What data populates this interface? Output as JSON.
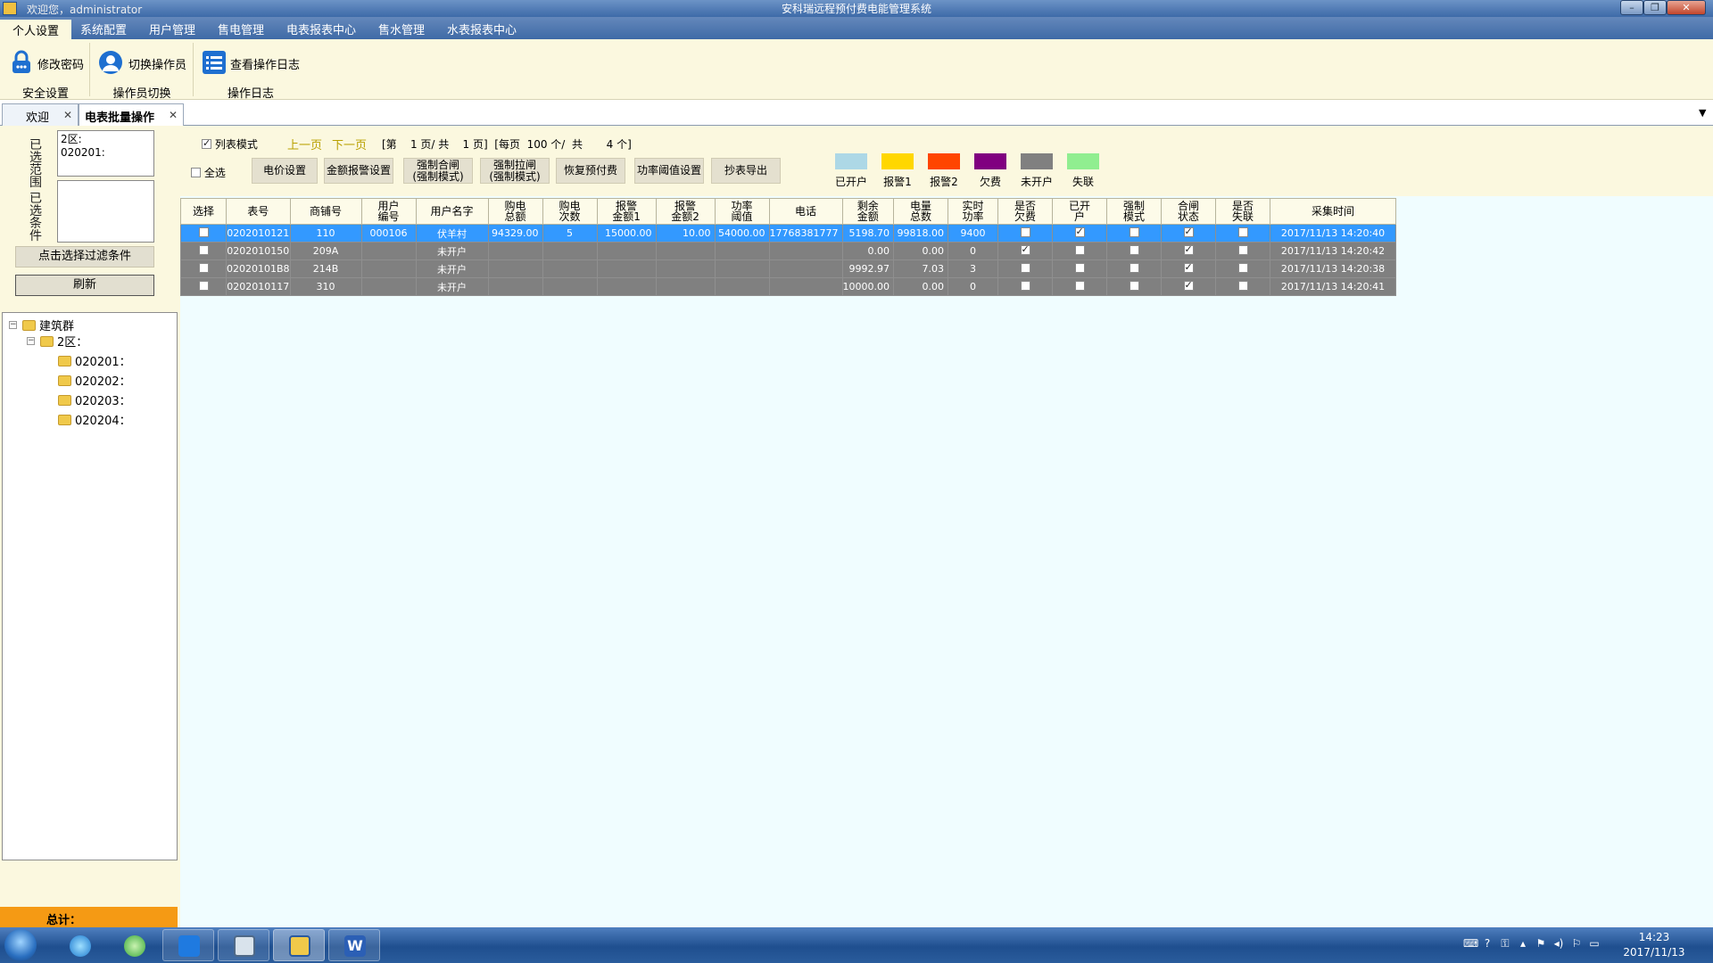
{
  "window": {
    "title": "安科瑞远程预付费电能管理系统",
    "welcome": "欢迎您，administrator"
  },
  "menu": [
    "个人设置",
    "系统配置",
    "用户管理",
    "售电管理",
    "电表报表中心",
    "售水管理",
    "水表报表中心"
  ],
  "ribbon": {
    "buttons": [
      "修改密码",
      "切换操作员",
      "查看操作日志"
    ],
    "groups": [
      "安全设置",
      "操作员切换",
      "操作日志"
    ]
  },
  "tabs": [
    {
      "label": "欢迎"
    },
    {
      "label": "电表批量操作"
    }
  ],
  "left": {
    "range_label": "已选范围",
    "range_value": "2区:\n020201:",
    "cond_label": "已选条件",
    "cond_value": "",
    "filter_btn": "点击选择过滤条件",
    "refresh_btn": "刷新",
    "tree": {
      "root": "建筑群",
      "area": "2区：",
      "items": [
        "020201：",
        "020202：",
        "020203：",
        "020204："
      ]
    },
    "total_label": "总计："
  },
  "toolbar": {
    "list_mode": "列表模式",
    "list_mode_checked": true,
    "prev_page": "上一页",
    "next_page": "下一页",
    "pager": "[第    1 页/ 共    1 页]  [每页  100 个/  共       4 个]",
    "select_all": "全选",
    "buttons": [
      "电价设置",
      "金额报警设置",
      "强制合闸\n(强制模式)",
      "强制拉闸\n(强制模式)",
      "恢复预付费",
      "功率阈值设置",
      "抄表导出"
    ]
  },
  "legend": [
    {
      "label": "已开户",
      "color": "#add8e6"
    },
    {
      "label": "报警1",
      "color": "#ffd700"
    },
    {
      "label": "报警2",
      "color": "#ff4500"
    },
    {
      "label": "欠费",
      "color": "#800080"
    },
    {
      "label": "未开户",
      "color": "#808080"
    },
    {
      "label": "失联",
      "color": "#90ee90"
    }
  ],
  "grid": {
    "columns": [
      "选择",
      "表号",
      "商铺号",
      "用户\n编号",
      "用户名字",
      "购电\n总额",
      "购电\n次数",
      "报警\n金额1",
      "报警\n金额2",
      "功率\n阈值",
      "电话",
      "剩余\n金额",
      "电量\n总数",
      "实时\n功率",
      "是否\n欠费",
      "已开\n户",
      "强制\n模式",
      "合闸\n状态",
      "是否\n失联",
      "采集时间"
    ],
    "rows": [
      {
        "selected": true,
        "meter": "0202010121",
        "shop": "110",
        "user_no": "000106",
        "user_name": "伏羊村",
        "buy_total": "94329.00",
        "buy_count": "5",
        "alarm1": "15000.00",
        "alarm2": "10.00",
        "power_limit": "54000.00",
        "phone": "17768381777",
        "remain": "5198.70",
        "energy": "99818.00",
        "power": "9400",
        "arrears": false,
        "opened": true,
        "forced": false,
        "closed": true,
        "offline": false,
        "time": "2017/11/13 14:20:40"
      },
      {
        "selected": false,
        "meter": "0202010150",
        "shop": "209A",
        "user_no": "",
        "user_name": "未开户",
        "buy_total": "",
        "buy_count": "",
        "alarm1": "",
        "alarm2": "",
        "power_limit": "",
        "phone": "",
        "remain": "0.00",
        "energy": "0.00",
        "power": "0",
        "arrears": true,
        "opened": false,
        "forced": false,
        "closed": true,
        "offline": false,
        "time": "2017/11/13 14:20:42"
      },
      {
        "selected": false,
        "meter": "02020101B8",
        "shop": "214B",
        "user_no": "",
        "user_name": "未开户",
        "buy_total": "",
        "buy_count": "",
        "alarm1": "",
        "alarm2": "",
        "power_limit": "",
        "phone": "",
        "remain": "9992.97",
        "energy": "7.03",
        "power": "3",
        "arrears": false,
        "opened": false,
        "forced": false,
        "closed": true,
        "offline": false,
        "time": "2017/11/13 14:20:38"
      },
      {
        "selected": false,
        "meter": "0202010117",
        "shop": "310",
        "user_no": "",
        "user_name": "未开户",
        "buy_total": "",
        "buy_count": "",
        "alarm1": "",
        "alarm2": "",
        "power_limit": "",
        "phone": "",
        "remain": "10000.00",
        "energy": "0.00",
        "power": "0",
        "arrears": false,
        "opened": false,
        "forced": false,
        "closed": true,
        "offline": false,
        "time": "2017/11/13 14:20:41"
      }
    ]
  },
  "taskbar": {
    "time": "14:23",
    "date": "2017/11/13"
  }
}
